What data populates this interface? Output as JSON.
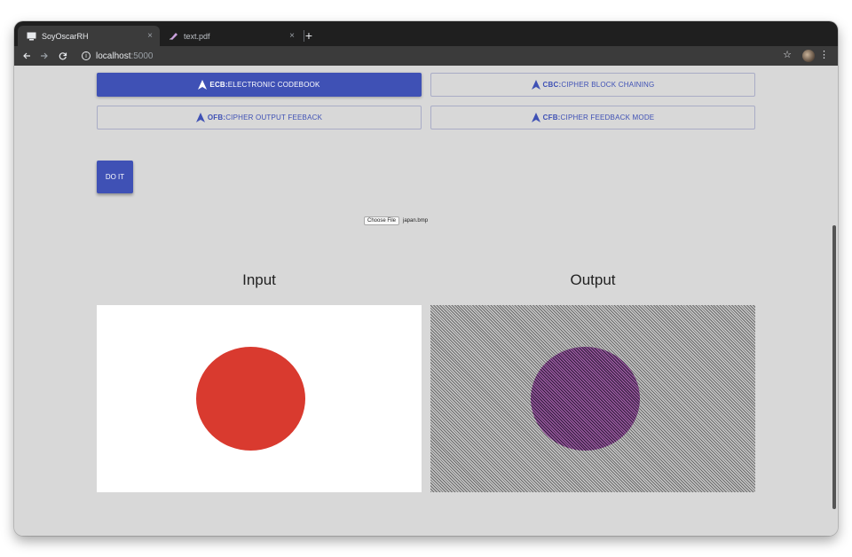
{
  "browser": {
    "tabs": [
      {
        "title": "SoyOscarRH",
        "active": true
      },
      {
        "title": "text.pdf",
        "active": false
      }
    ],
    "new_tab": "+",
    "close_glyph": "×",
    "url_host": "localhost",
    "url_port": ":5000"
  },
  "modes": [
    {
      "abbr": "ECB:",
      "label": "ELECTRONIC CODEBOOK",
      "selected": true
    },
    {
      "abbr": "CBC:",
      "label": "CIPHER BLOCK CHAINING",
      "selected": false
    },
    {
      "abbr": "OFB:",
      "label": "CIPHER OUTPUT FEEBACK",
      "selected": false
    },
    {
      "abbr": "CFB:",
      "label": "CIPHER FEEDBACK MODE",
      "selected": false
    }
  ],
  "actions": {
    "do_it": "DO IT"
  },
  "file_input": {
    "button": "Choose File",
    "filename": "japan.bmp"
  },
  "panels": {
    "input_title": "Input",
    "output_title": "Output"
  },
  "colors": {
    "accent": "#3f51b5",
    "circle": "#d93a2f",
    "output_circle": "#9a5aa0"
  },
  "icons": [
    "monitor-icon",
    "pdf-icon",
    "arrow-left-icon",
    "arrow-right-icon",
    "reload-icon",
    "info-icon",
    "star-icon",
    "avatar",
    "kebab-icon",
    "lock-icon"
  ]
}
